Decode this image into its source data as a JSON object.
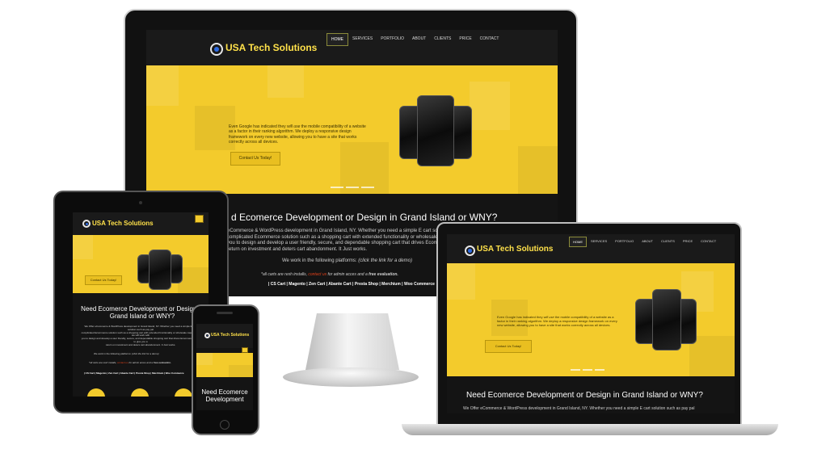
{
  "site": {
    "logo_text": "USA Tech Solutions",
    "menu": [
      "HOME",
      "SERVICES",
      "PORTFOLIO",
      "ABOUT",
      "CLIENTS",
      "PRICE",
      "CONTACT"
    ],
    "hero_text_1": "Even Google has indicated they ",
    "hero_text_em": "will use",
    "hero_text_2": " the mobile compatibility of a website as a factor in their ranking algorithm. We deploy a responsive design framework on every new website, allowing you to have a site that works correctly across all devices.",
    "cta_label": "Contact Us Today!",
    "heading": "Need Ecomerce Development or Design in Grand Island or WNY?",
    "heading_cut": "d Ecomerce Development or Design in Grand Island or WNY?",
    "intro_1": "eCommerce & WordPress development in Grand Island, NY. Whether you need a simple E cart solution such as pay pal",
    "intro_2": "complicated Ecommerce solution such as a shopping cart with extended functionality or wholesale capabilities, we will work with",
    "intro_3": "you to design and develop a user friendly, secure, and dependable shopping cart that drives Ecommerce sales to give you a",
    "intro_4": "return on investment and deters cart abandonment. It Just works.",
    "laptop_intro": "We Offer eCommerce & WordPress development in Grand Island, NY. Whether you need a simple E cart solution such as pay pal",
    "platforms_intro": "We work in the following platforms:",
    "platforms_hint": "(click the link for a demo)",
    "note_1": "*all carts are resh installs, ",
    "note_link": "contact us",
    "note_2": " for admin acces and a ",
    "note_bold": "free evaluation.",
    "platforms": "| CS Cart | Magento | Zen Cart | Abante Cart | Presta Shop | Merchium | Woo Commerce",
    "phone_heading": "Need Ecomerce Development",
    "tablet_menu_icon": "hamburger-icon"
  },
  "colors": {
    "brand_yellow": "#f3cb2c",
    "dark_bg": "#141414",
    "logo_yellow": "#ffe14a"
  }
}
